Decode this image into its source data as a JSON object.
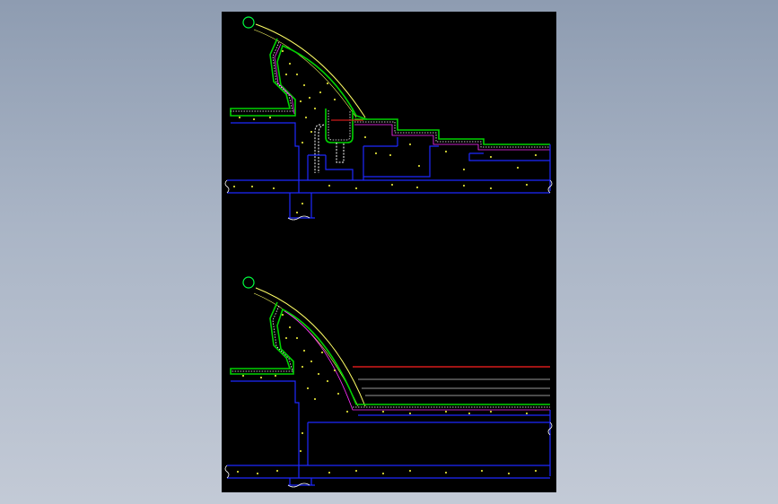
{
  "viewer": {
    "background_top": "#8e9cb1",
    "background_bottom": "#c3cad6",
    "sheet_color": "#000000"
  },
  "palette": {
    "structure_line": "#1e28ff",
    "finish_line": "#00d200",
    "finish_hatch": "#ffffff",
    "membrane_line": "#ff2dff",
    "waterline": "#ff2020",
    "arc_line": "#ffff66",
    "stair_line": "#c8c8c8",
    "aggregate_dots": "#ffff40",
    "pipe_line": "#ffffff",
    "nozzle_circle": "#00ff40"
  },
  "views": [
    {
      "id": "section-upper",
      "description_visible": false
    },
    {
      "id": "section-lower",
      "description_visible": false
    }
  ]
}
